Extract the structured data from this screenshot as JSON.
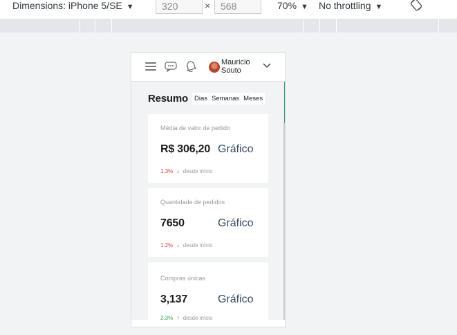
{
  "devtools": {
    "dimensions_label": "Dimensions: iPhone 5/SE",
    "width_value": "320",
    "times_sign": "×",
    "height_value": "568",
    "zoom_label": "70%",
    "throttle_label": "No throttling",
    "caret": "▼"
  },
  "app": {
    "user_name": "Mauricio Souto"
  },
  "summary": {
    "title": "Resumo",
    "tabs": [
      "Dias",
      "Semanas",
      "Meses"
    ]
  },
  "cards": [
    {
      "label": "Média de valor de pedido",
      "value": "R$ 306,20",
      "link": "Gráfico",
      "delta": "1.3%",
      "direction": "down",
      "arrow": "↓",
      "since": "desde início"
    },
    {
      "label": "Quantidade de pedidos",
      "value": "7650",
      "link": "Gráfico",
      "delta": "1.2%",
      "direction": "down",
      "arrow": "↓",
      "since": "desde início"
    },
    {
      "label": "Compras únicas",
      "value": "3,137",
      "link": "Gráfico",
      "delta": "2.3%",
      "direction": "up",
      "arrow": "↑",
      "since": "desde início"
    }
  ],
  "colors": {
    "accent_link": "#344a63",
    "down": "#e04040",
    "up": "#3aa54a",
    "scroll_thumb": "#3a9a6a"
  },
  "icons": [
    "hamburger-icon",
    "chat-icon",
    "bell-icon",
    "chevron-down-icon",
    "rotate-icon"
  ]
}
